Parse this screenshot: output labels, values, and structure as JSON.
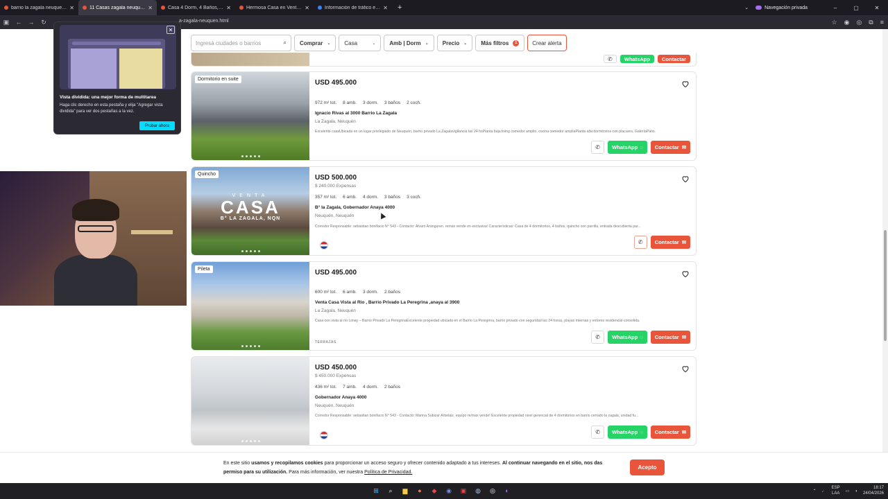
{
  "browser": {
    "tabs": [
      {
        "title": "barrio la zagala neuquen - Bus",
        "active": false
      },
      {
        "title": "11 Casas zagala neuquen en ve",
        "active": true
      },
      {
        "title": "Casa 4 Dorm, 4 Baños, Quinchc",
        "active": false
      },
      {
        "title": "Hermosa Casa en Venta B° La Z",
        "active": false
      },
      {
        "title": "Información de tráfico en tiemp",
        "active": false
      }
    ],
    "private_label": "Navegación privada",
    "url": "a-zagala-neuquen.html"
  },
  "filters": {
    "search_placeholder": "Ingresá ciudades o barrios",
    "operation": "Comprar",
    "type": "Casa",
    "rooms": "Amb | Dorm",
    "price": "Precio",
    "more": "Más filtros",
    "more_count": "1",
    "alert": "Crear alerta"
  },
  "listings": [
    {
      "tag": "Dormitorio en suite",
      "price": "USD 495.000",
      "expenses": "",
      "features": [
        "972 m² tot.",
        "8 amb.",
        "3 dorm.",
        "3 baños",
        "2 coch."
      ],
      "address": "Ignacio Rivas al 3000 Barrio La Zagala",
      "location": "La Zagala, Neuquén",
      "description": "Excelente casaUbicada en un lugar privilegiado de Neuquén, barrio privado La Zagalavigilancia las 24 hsPlanta baja:living comedor amplio, cocina comedor ampliaPlanta alta:dormitorios con placares, GaleríaPatio.",
      "whatsapp": "WhatsApp",
      "contact": "Contactar"
    },
    {
      "tag": "Quincho",
      "price": "USD 500.000",
      "expenses": "$ 240.000 Expensas",
      "features": [
        "357 m² tot.",
        "6 amb.",
        "4 dorm.",
        "3 baños",
        "3 coch."
      ],
      "address": "B° la Zagala, Gobernador Anaya 4000",
      "location": "Neuquén, Neuquén",
      "description": "Corredor Responsable: sebastian bonifacio N° 543 - Contacto: Alvaro Aranguren. remax vende en exclusiva! Características: Casa de 4 dormitorios, 4 baños, quincho con parrilla, entrada descubierta par...",
      "photo_text_top": "VENTA",
      "photo_text_main": "CASA",
      "photo_text_sub": "B° LA ZAGALA, NQN",
      "contact": "Contactar"
    },
    {
      "tag": "Pileta",
      "price": "USD 495.000",
      "expenses": "",
      "features": [
        "600 m² tot.",
        "6 amb.",
        "3 dorm.",
        "2 baños"
      ],
      "address": "Venta Casa Vista al Rio , Barrio Privado La Peregrina ,anaya al 3900",
      "location": "La Zagala, Neuquén",
      "description": "Casa con vista al río Limay – Barrio Privado La PeregrinaExcelente propiedad ubicada en el Barrio La Peregrina, barrio privado con seguridad las 24 horas, playas internas y entorno residencial consolida.",
      "agency": "TERRAZAS",
      "whatsapp": "WhatsApp",
      "contact": "Contactar"
    },
    {
      "tag": "",
      "price": "USD 450.000",
      "expenses": "$ 450.000 Expensas",
      "features": [
        "436 m² tot.",
        "7 amb.",
        "4 dorm.",
        "2 baños"
      ],
      "address": "Gobernador Anaya 4000",
      "location": "Neuquén, Neuquén",
      "description": "Corredor Responsable: sebastian bonifacio N° 543 - Contacto: Marina Subizar Arbeláiz. equipo re/max vende! Excelente propiedad nivel gerencial de 4 dormitorios en barrio cerrado la zagala, unidad fu...",
      "whatsapp": "WhatsApp",
      "contact": "Contactar"
    }
  ],
  "top_card": {
    "whatsapp": "WhatsApp",
    "contact": "Contactar"
  },
  "popup": {
    "title": "Vista dividida: una mejor forma de multitarea",
    "body": "Haga clic derecho en esta pestaña y elija \"Agregar vista dividida\" para ver dos pestañas a la vez.",
    "button": "Probar ahora"
  },
  "cookie": {
    "t1": "En este sitio ",
    "b1": "usamos y recopilamos cookies",
    "t2": " para proporcionar un acceso seguro y ofrecer contenido adaptado a tus intereses. ",
    "b2": "Al continuar navegando en el sitio, nos das permiso para su utilización.",
    "t3": " Para más información, ver nuestra ",
    "link": "Política de Privacidad.",
    "accept": "Acepto"
  },
  "taskbar": {
    "lang_top": "ESP",
    "lang_bottom": "LAA",
    "time": "18:17",
    "date": "24/04/2026"
  },
  "colors": {
    "accent": "#e8553b",
    "whatsapp": "#25d366",
    "popup_button": "#00ddff"
  }
}
